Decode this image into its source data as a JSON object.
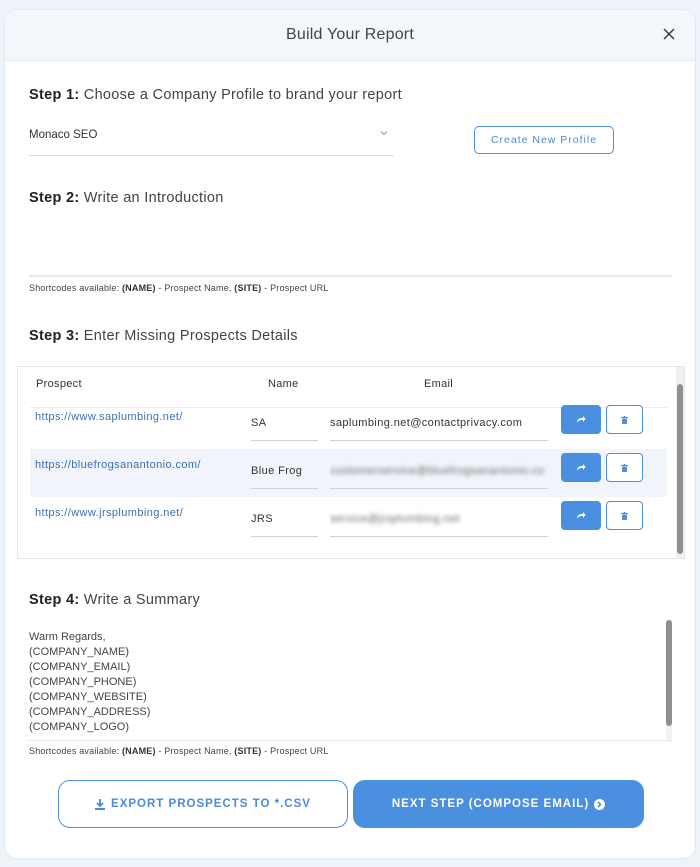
{
  "modal": {
    "title": "Build Your Report",
    "close_icon": "close-icon"
  },
  "step1": {
    "label": "Step 1:",
    "text": "Choose a Company Profile to brand your report",
    "profile_select": {
      "value": "Monaco SEO",
      "icon": "chevron-down-icon"
    },
    "create_profile_label": "Create New Profile"
  },
  "step2": {
    "label": "Step 2:",
    "text": "Write an Introduction",
    "intro_value": "",
    "shortcodes": {
      "prefix": "Shortcodes available: ",
      "code1": "(NAME)",
      "desc1": " - Prospect Name, ",
      "code2": "(SITE)",
      "desc2": " - Prospect URL"
    }
  },
  "step3": {
    "label": "Step 3:",
    "text": "Enter Missing Prospects Details",
    "columns": [
      "Prospect",
      "Name",
      "Email"
    ],
    "rows": [
      {
        "prospect": "https://www.saplumbing.net/",
        "name": "SA Plumbing",
        "email": "saplumbing.net@contactprivacy.com",
        "email_blurred": false
      },
      {
        "prospect": "https://bluefrogsanantonio.com/",
        "name": "Blue Frog",
        "email": "customerservice@bluefrogsanantonio.co",
        "email_blurred": true
      },
      {
        "prospect": "https://www.jrsplumbing.net/",
        "name": "JRS Plumbing",
        "email": "service@jrsplumbing.net",
        "email_blurred": true
      }
    ],
    "row_actions": {
      "send_icon": "share-arrow-icon",
      "delete_icon": "trash-icon"
    }
  },
  "step4": {
    "label": "Step 4:",
    "text": "Write a Summary",
    "summary_lines": [
      "Warm Regards,",
      "(COMPANY_NAME)",
      "(COMPANY_EMAIL)",
      "(COMPANY_PHONE)",
      "(COMPANY_WEBSITE)",
      "(COMPANY_ADDRESS)",
      "(COMPANY_LOGO)"
    ],
    "shortcodes": {
      "prefix": "Shortcodes available: ",
      "code1": "(NAME)",
      "desc1": " - Prospect Name, ",
      "code2": "(SITE)",
      "desc2": " - Prospect URL"
    }
  },
  "footer": {
    "export_label": "EXPORT PROSPECTS TO *.CSV",
    "export_icon": "download-icon",
    "next_label": "NEXT STEP (COMPOSE EMAIL)",
    "next_icon": "arrow-circle-right-icon"
  },
  "colors": {
    "accent": "#4a8fe0",
    "link": "#3a6fb5",
    "header_bg": "#f3f6fb",
    "row_alt_bg": "#f1f5fb"
  }
}
